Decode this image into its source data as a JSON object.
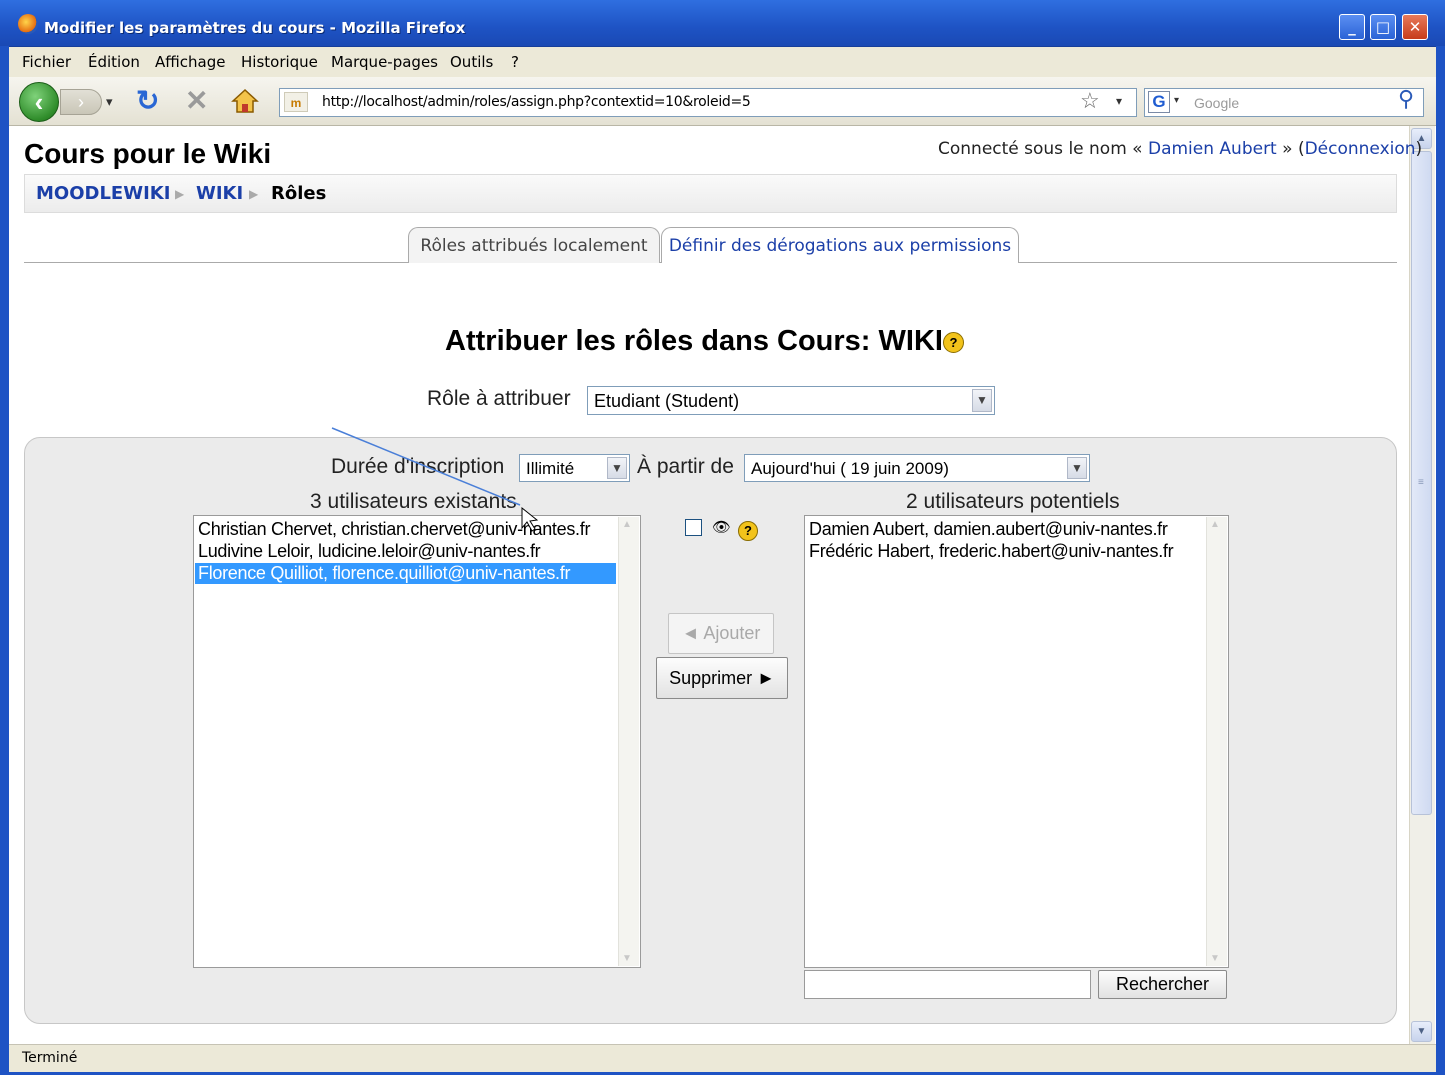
{
  "window": {
    "title": "Modifier les paramètres du cours - Mozilla Firefox",
    "minimize": "_",
    "maximize": "□",
    "close": "✕"
  },
  "menubar": {
    "items": [
      "Fichier",
      "Édition",
      "Affichage",
      "Historique",
      "Marque-pages",
      "Outils",
      "?"
    ]
  },
  "navbar": {
    "url": "http://localhost/admin/roles/assign.php?contextid=10&roleid=5",
    "search_placeholder": "Google",
    "icons": [
      "back-icon",
      "forward-icon",
      "reload-icon",
      "stop-icon",
      "home-icon",
      "bookmark-star-icon",
      "google-icon",
      "search-icon"
    ]
  },
  "page": {
    "course_title": "Cours pour le Wiki",
    "login_prefix": "Connecté sous le nom « ",
    "login_user": "Damien Aubert",
    "login_mid": " » (",
    "logout": "Déconnexion",
    "login_suffix": ")",
    "breadcrumb": [
      "MOODLEWIKI",
      "WIKI",
      "Rôles"
    ],
    "tabs": [
      "Rôles attribués localement",
      "Définir des dérogations aux permissions"
    ],
    "heading": "Attribuer les rôles dans Cours: WIKI",
    "role_label": "Rôle à attribuer",
    "role_value": "Etudiant (Student)",
    "duration_label": "Durée d'inscription",
    "duration_value": "Illimité",
    "from_label": "À partir de",
    "from_value": "Aujourd'hui ( 19 juin 2009)",
    "existing_label": "3 utilisateurs existants",
    "existing_users": [
      "Christian Chervet, christian.chervet@univ-nantes.fr",
      "Ludivine Leloir, ludicine.leloir@univ-nantes.fr",
      "Florence Quilliot, florence.quilliot@univ-nantes.fr"
    ],
    "selected_existing_index": 2,
    "potential_label": "2 utilisateurs potentiels",
    "potential_users": [
      "Damien Aubert, damien.aubert@univ-nantes.fr",
      "Frédéric Habert, frederic.habert@univ-nantes.fr"
    ],
    "add_button": "◄ Ajouter",
    "remove_button": "Supprimer ►",
    "search_button": "Rechercher",
    "search_value": ""
  },
  "statusbar": {
    "text": "Terminé"
  },
  "colors": {
    "titlebar": "#1e53c4",
    "link": "#1b3fa8",
    "selection": "#3399ff",
    "annotation_arrow": "#4a7fd8"
  }
}
